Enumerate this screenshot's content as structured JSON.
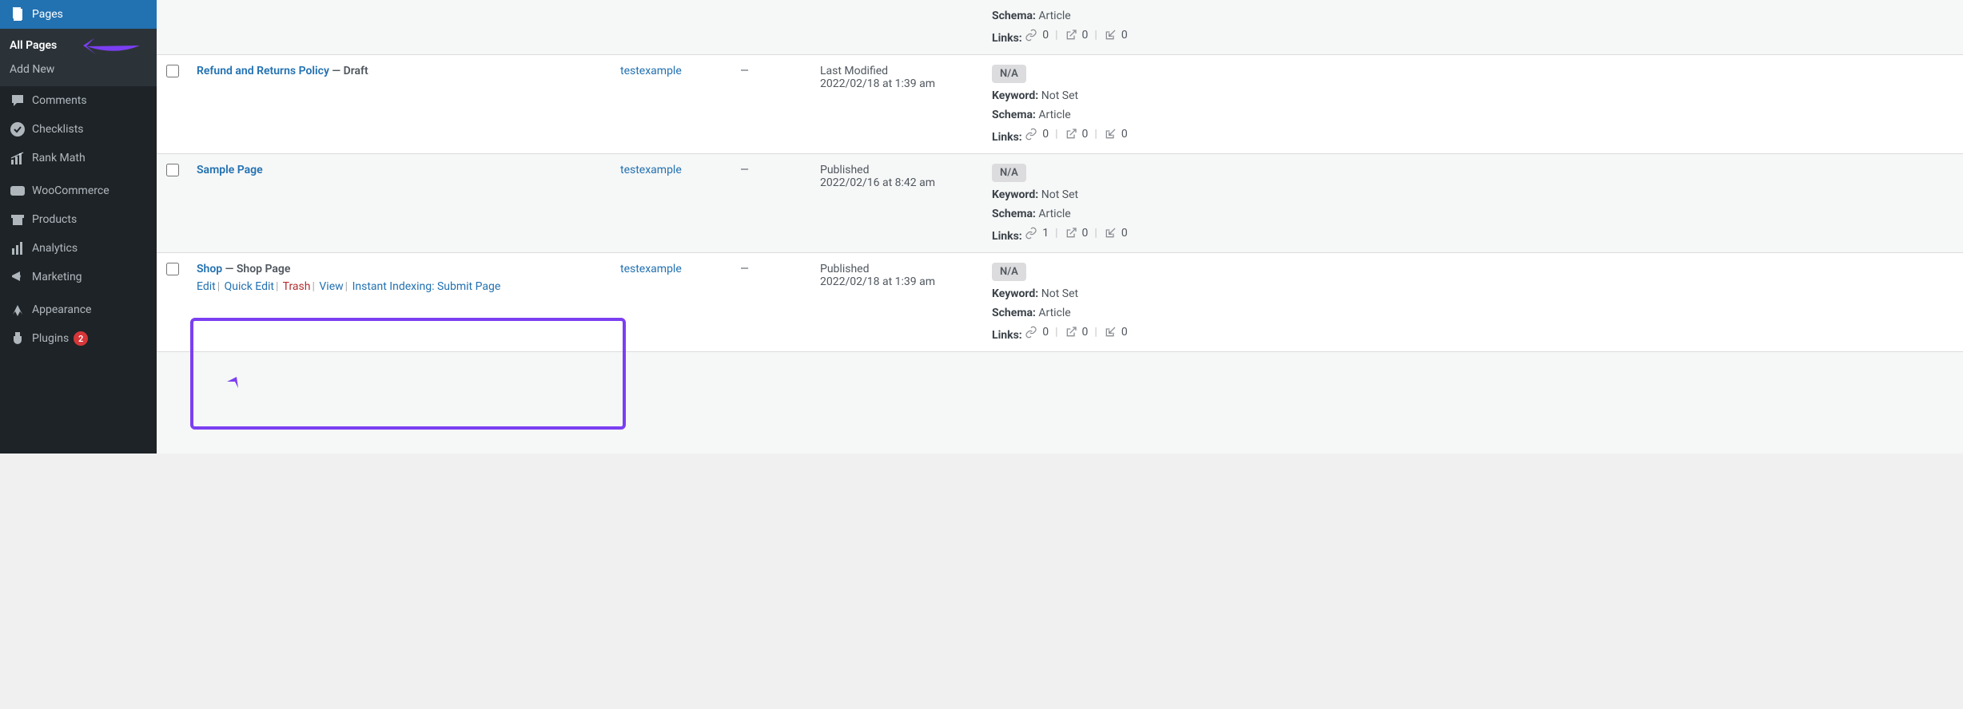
{
  "sidebar": {
    "pages": "Pages",
    "all_pages": "All Pages",
    "add_new": "Add New",
    "comments": "Comments",
    "checklists": "Checklists",
    "rank_math": "Rank Math",
    "woocommerce": "WooCommerce",
    "products": "Products",
    "analytics": "Analytics",
    "marketing": "Marketing",
    "appearance": "Appearance",
    "plugins": "Plugins",
    "plugins_count": "2"
  },
  "rows": [
    {
      "schema_label": "Schema:",
      "schema_value": "Article",
      "links_label": "Links:",
      "link1": "0",
      "link2": "0",
      "link3": "0"
    },
    {
      "title": "Refund and Returns Policy",
      "state": " — Draft",
      "author": "testexample",
      "comments": "—",
      "date_label": "Last Modified",
      "date_value": "2022/02/18 at 1:39 am",
      "na": "N/A",
      "keyword_label": "Keyword:",
      "keyword_value": "Not Set",
      "schema_label": "Schema:",
      "schema_value": "Article",
      "links_label": "Links:",
      "link1": "0",
      "link2": "0",
      "link3": "0"
    },
    {
      "title": "Sample Page",
      "state": "",
      "author": "testexample",
      "comments": "—",
      "date_label": "Published",
      "date_value": "2022/02/16 at 8:42 am",
      "na": "N/A",
      "keyword_label": "Keyword:",
      "keyword_value": "Not Set",
      "schema_label": "Schema:",
      "schema_value": "Article",
      "links_label": "Links:",
      "link1": "1",
      "link2": "0",
      "link3": "0"
    },
    {
      "title": "Shop",
      "state": " — Shop Page",
      "author": "testexample",
      "comments": "—",
      "date_label": "Published",
      "date_value": "2022/02/18 at 1:39 am",
      "na": "N/A",
      "actions": {
        "edit": "Edit",
        "quick_edit": "Quick Edit",
        "trash": "Trash",
        "view": "View",
        "instant": "Instant Indexing: Submit Page"
      },
      "keyword_label": "Keyword:",
      "keyword_value": "Not Set",
      "schema_label": "Schema:",
      "schema_value": "Article",
      "links_label": "Links:",
      "link1": "0",
      "link2": "0",
      "link3": "0"
    }
  ]
}
